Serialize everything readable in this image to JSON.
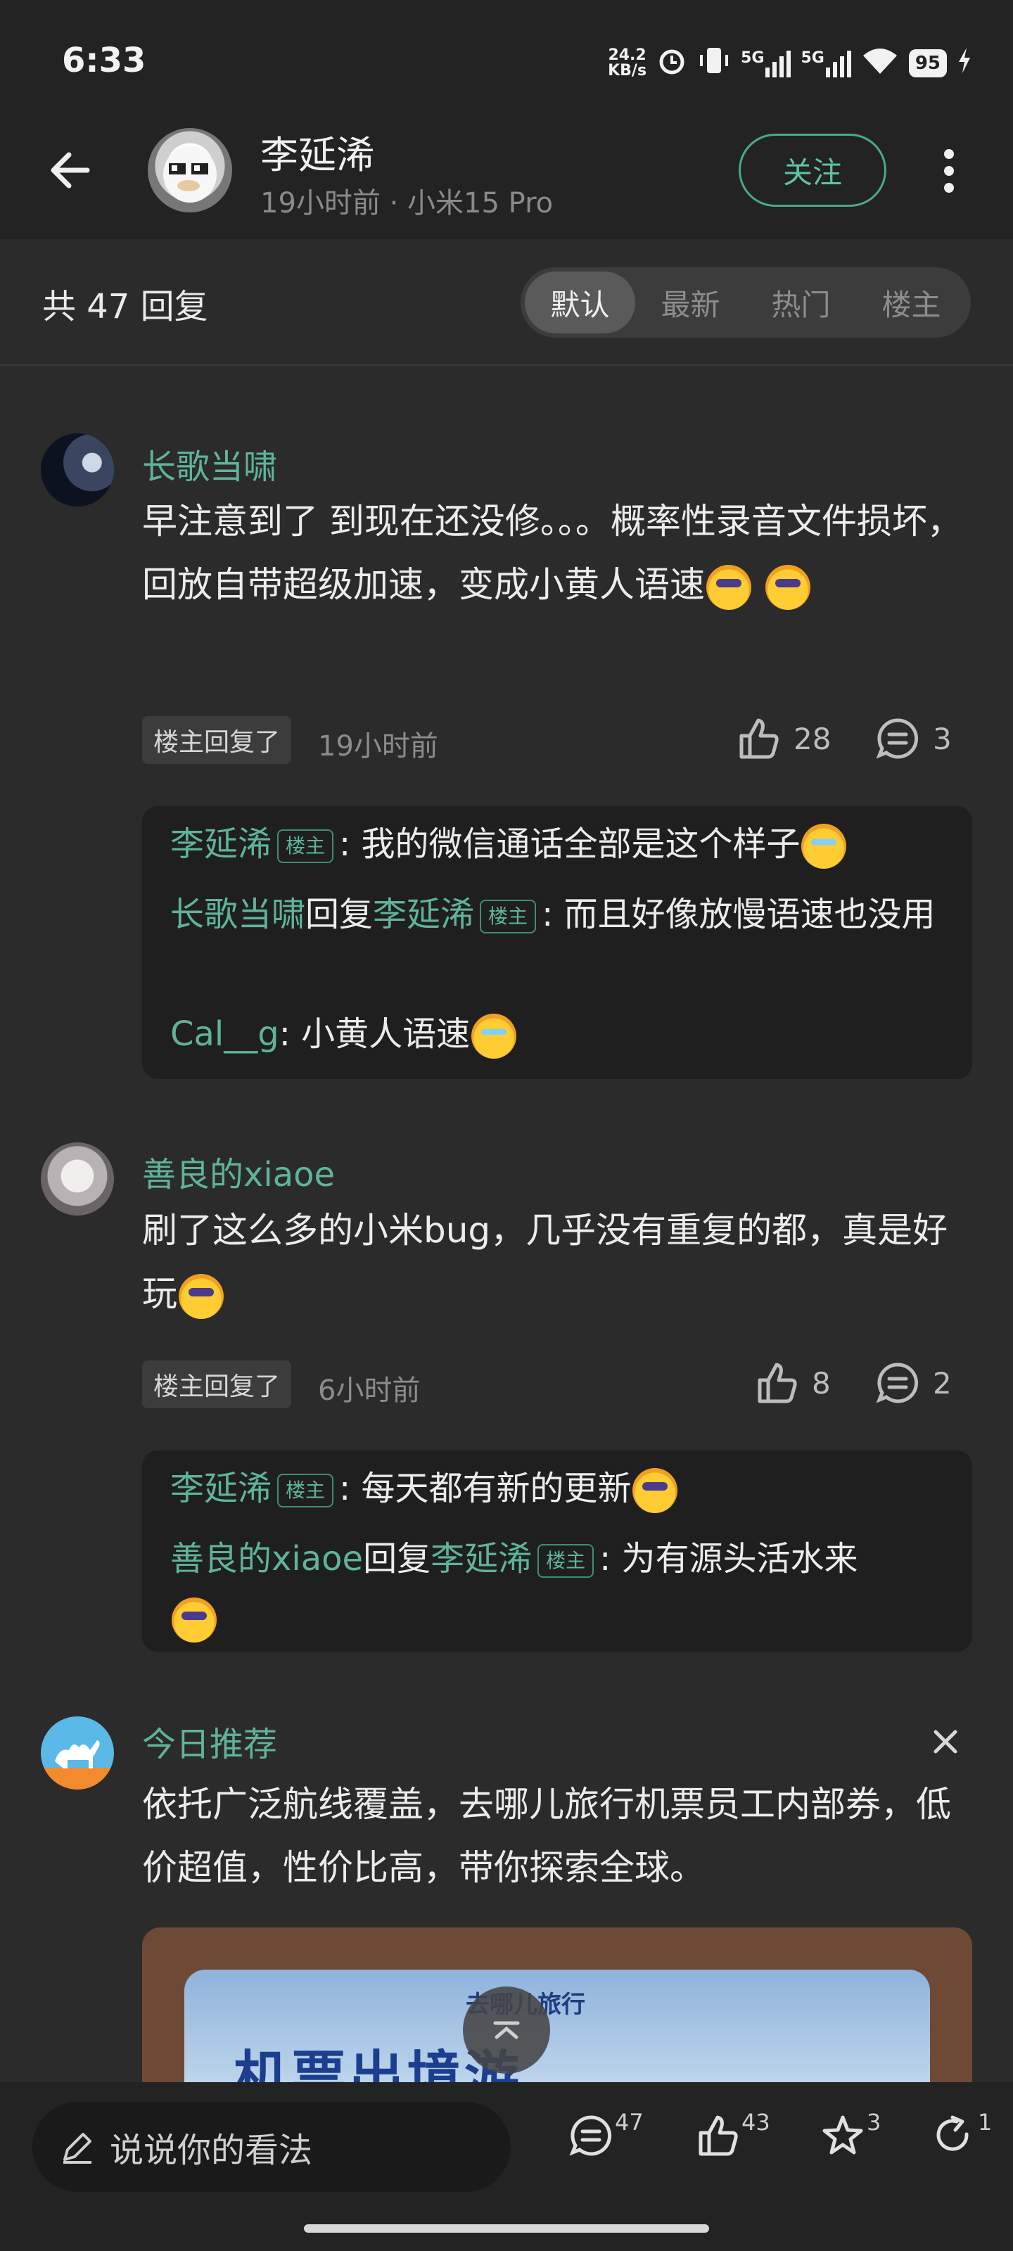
{
  "status_bar": {
    "time": "6:33",
    "net_speed": "24.2",
    "net_unit": "KB/s",
    "signal1": "5G",
    "signal2": "5G",
    "battery": "95"
  },
  "header": {
    "user_name": "李延浠",
    "meta": "19小时前 · 小米15 Pro",
    "follow_label": "关注"
  },
  "reply_bar": {
    "count_label": "共 47 回复",
    "tabs": [
      "默认",
      "最新",
      "热门",
      "楼主"
    ],
    "active_tab": "默认"
  },
  "comments": [
    {
      "name": "长歌当啸",
      "text": "早注意到了 到现在还没修。。。概率性录音文件损坏，回放自带超级加速，变成小黄人语速",
      "op_tag": "楼主回复了",
      "time": "19小时前",
      "likes": "28",
      "replies_count": "3",
      "replies": [
        {
          "author": "李延浠",
          "badge": "楼主",
          "text": ": 我的微信通话全部是这个样子"
        },
        {
          "author": "长歌当啸",
          "reply_word": "回复",
          "target": "李延浠",
          "badge": "楼主",
          "text": ": 而且好像放慢语速也没用"
        },
        {
          "author": "Cal__g",
          "text": ": 小黄人语速"
        }
      ]
    },
    {
      "name": "善良的xiaoe",
      "text": "刷了这么多的小米bug，几乎没有重复的都，真是好玩",
      "op_tag": "楼主回复了",
      "time": "6小时前",
      "likes": "8",
      "replies_count": "2",
      "replies": [
        {
          "author": "李延浠",
          "badge": "楼主",
          "text": ": 每天都有新的更新"
        },
        {
          "author": "善良的xiaoe",
          "reply_word": "回复",
          "target": "李延浠",
          "badge": "楼主",
          "text": ": 为有源头活水来"
        }
      ]
    }
  ],
  "ad": {
    "name": "今日推荐",
    "text": "依托广泛航线覆盖，去哪儿旅行机票员工内部券，低价超值，性价比高，带你探索全球。",
    "banner_brand": "去哪儿旅行",
    "banner_title": "机票出境游"
  },
  "bottom_bar": {
    "placeholder": "说说你的看法",
    "comments": "47",
    "likes": "43",
    "stars": "3",
    "shares": "1"
  },
  "colors": {
    "accent": "#5fb39b",
    "background": "#2b2b2b",
    "sub_box": "#1f1f1f"
  }
}
